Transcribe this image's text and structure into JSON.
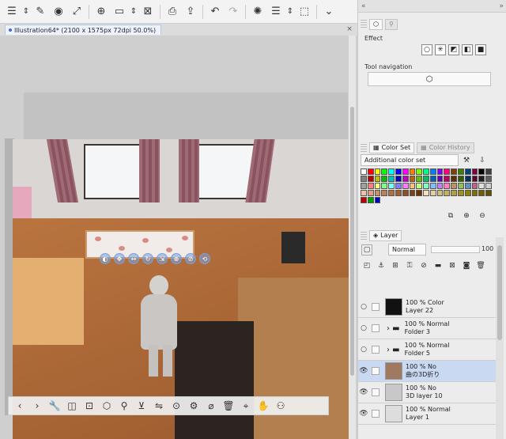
{
  "toolbar": {
    "icons": [
      "menu-icon",
      "updown-icon",
      "edit-icon",
      "record-icon",
      "resize-icon",
      "new-icon",
      "open-icon",
      "updown-icon",
      "close-box-icon",
      "print-icon",
      "export-icon",
      "undo-icon",
      "redo-icon",
      "spinner-icon",
      "layer-stack-icon",
      "updown-icon",
      "select-icon",
      "chevron-down-icon"
    ]
  },
  "document_tab": {
    "label": "Illustration64* (2100 x 1575px 72dpi 50.0%)",
    "close": "×"
  },
  "right_panel": {
    "collapse_left": "«",
    "collapse_right": "»",
    "effect_label": "Effect",
    "tool_navigation_label": "Tool navigation",
    "color_tabs": [
      {
        "label": "Color Set",
        "active": true
      },
      {
        "label": "Color History",
        "active": false
      }
    ],
    "color_set_dropdown": "Additional color set",
    "layer_tab": "Layer",
    "blend_mode": "Normal",
    "opacity": "100",
    "layers": [
      {
        "line1": "100 % Color",
        "line2": "Layer 22",
        "thumb": "#111111",
        "selected": false,
        "eye": "",
        "folder": false
      },
      {
        "line1": "100 % Normal",
        "line2": "Folder 3",
        "thumb": "",
        "selected": false,
        "eye": "",
        "folder": true
      },
      {
        "line1": "100 % Normal",
        "line2": "Folder 5",
        "thumb": "",
        "selected": false,
        "eye": "",
        "folder": true
      },
      {
        "line1": "100 % No",
        "line2": "曲の3D折り",
        "thumb": "#a07a60",
        "selected": true,
        "eye": "👁",
        "folder": false
      },
      {
        "line1": "100 % No",
        "line2": "3D layer 10",
        "thumb": "#c8c8c8",
        "selected": false,
        "eye": "👁",
        "folder": false
      },
      {
        "line1": "100 % Normal",
        "line2": "Layer 1",
        "thumb": "#dddddd",
        "selected": false,
        "eye": "👁",
        "folder": false
      }
    ]
  },
  "colors": {
    "accent": "#3a6fd0",
    "selected_row": "#c9d9f2",
    "palette": [
      "#ffffff",
      "#ff0000",
      "#ffff00",
      "#00ff00",
      "#00ffff",
      "#0000ff",
      "#ff00ff",
      "#ff8000",
      "#80ff00",
      "#00ff80",
      "#0080ff",
      "#8000ff",
      "#ff0080",
      "#804000",
      "#408000",
      "#004080",
      "#800040",
      "#000000",
      "#404040",
      "#808080",
      "#c00000",
      "#c0c000",
      "#00c000",
      "#00c0c0",
      "#0000c0",
      "#c000c0",
      "#c06000",
      "#60c000",
      "#00c060",
      "#0060c0",
      "#6000c0",
      "#c00060",
      "#603000",
      "#306000",
      "#003060",
      "#600030",
      "#202020",
      "#606060",
      "#a0a0a0",
      "#ff8080",
      "#ffff80",
      "#80ff80",
      "#80ffff",
      "#8080ff",
      "#ff80ff",
      "#ffc080",
      "#c0ff80",
      "#80ffc0",
      "#80c0ff",
      "#c080ff",
      "#ff80c0",
      "#c09060",
      "#90c060",
      "#6090c0",
      "#c06090",
      "#e0e0e0",
      "#d0d0d0",
      "#f0c0a0",
      "#e0a080",
      "#d09060",
      "#c08050",
      "#b07040",
      "#a06030",
      "#905020",
      "#804010",
      "#703000",
      "#f0e0c0",
      "#e0d0a0",
      "#d0c080",
      "#c0b060",
      "#b0a040",
      "#a09020",
      "#908000",
      "#807000",
      "#706000",
      "#605000",
      "#c00000",
      "#00a000",
      "#0000c0"
    ]
  }
}
